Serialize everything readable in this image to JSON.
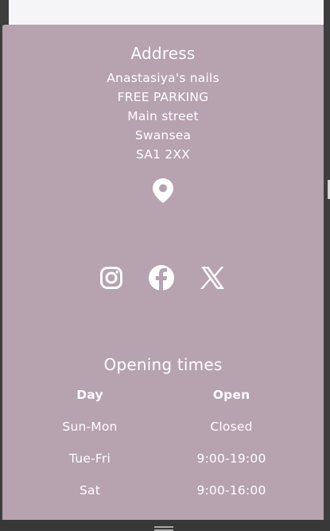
{
  "colors": {
    "panel": "#b7a2b0",
    "text": "#ffffff",
    "top_card": "#f5f4f6",
    "background": "#3d3d3d"
  },
  "address": {
    "title": "Address",
    "lines": [
      "Anastasiya's nails",
      "FREE PARKING",
      "Main street",
      "Swansea",
      "SA1 2XX"
    ],
    "icon": "map-pin-icon"
  },
  "social": {
    "icons": [
      "instagram-icon",
      "facebook-icon",
      "x-icon"
    ]
  },
  "opening": {
    "title": "Opening times",
    "headers": {
      "day": "Day",
      "open": "Open"
    },
    "rows": [
      {
        "day": "Sun-Mon",
        "open": "Closed"
      },
      {
        "day": "Tue-Fri",
        "open": "9:00-19:00"
      },
      {
        "day": "Sat",
        "open": "9:00-16:00"
      }
    ]
  }
}
